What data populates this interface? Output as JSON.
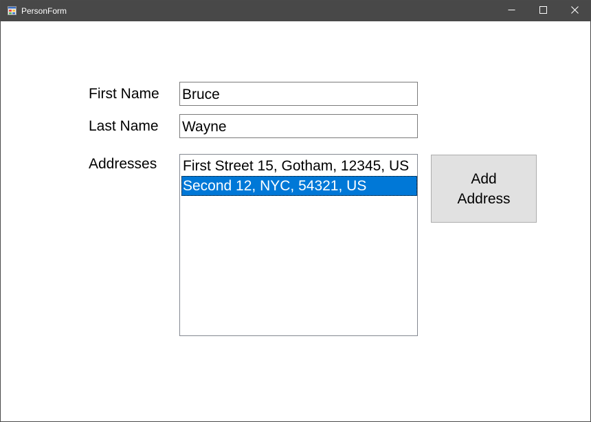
{
  "window": {
    "title": "PersonForm",
    "app_icon": "winforms-form-icon",
    "controls": {
      "minimize_icon": "minimize-icon",
      "maximize_icon": "maximize-icon",
      "close_icon": "close-icon"
    }
  },
  "form": {
    "first_name_label": "First Name",
    "first_name_value": "Bruce",
    "last_name_label": "Last Name",
    "last_name_value": "Wayne",
    "addresses_label": "Addresses",
    "addresses": [
      {
        "text": "First Street 15, Gotham, 12345, US",
        "selected": false
      },
      {
        "text": "Second 12, NYC, 54321, US",
        "selected": true
      }
    ],
    "add_address_button": "Add Address"
  },
  "colors": {
    "titlebar": "#484848",
    "selection": "#0078d7",
    "button_face": "#e1e1e1"
  }
}
